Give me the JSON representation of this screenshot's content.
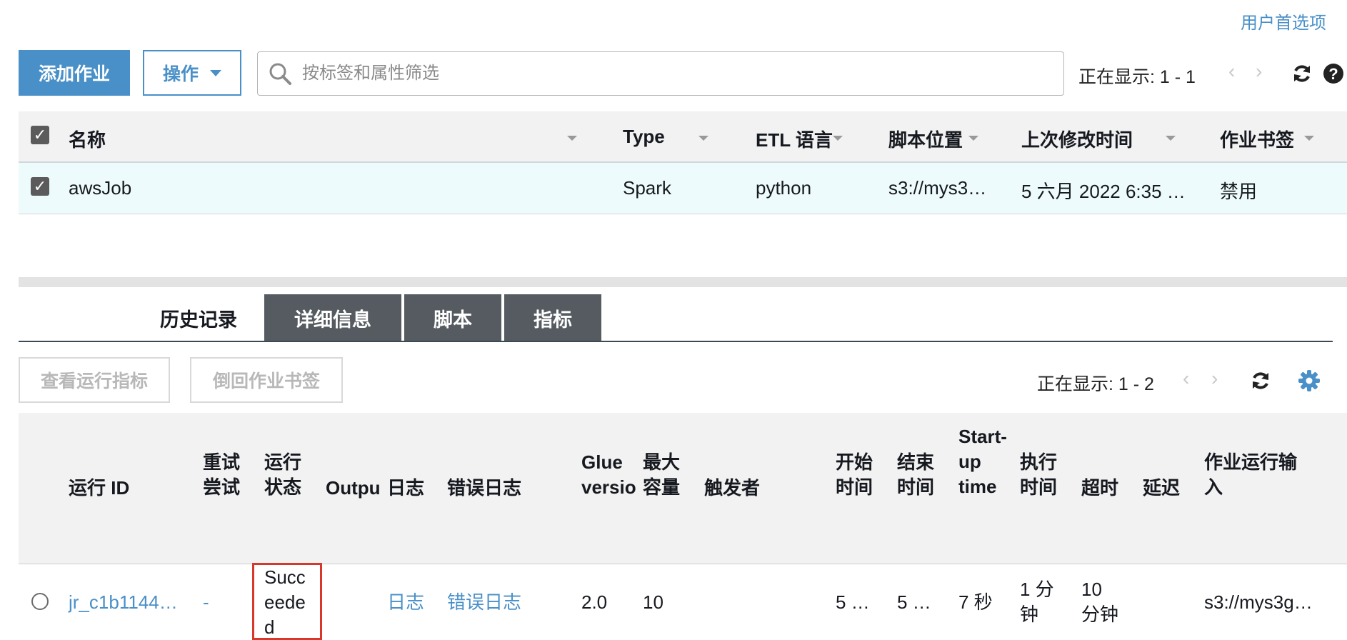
{
  "header": {
    "user_prefs": "用户首选项"
  },
  "toolbar": {
    "add_job": "添加作业",
    "actions": "操作",
    "search_placeholder": "按标签和属性筛选",
    "pager": "正在显示: 1 - 1",
    "prev": "‹",
    "next": "›"
  },
  "jobs_table": {
    "columns": [
      "名称",
      "Type",
      "ETL 语言",
      "脚本位置",
      "上次修改时间",
      "作业书签"
    ],
    "rows": [
      {
        "name": "awsJob",
        "type": "Spark",
        "etl": "python",
        "script": "s3://mys3…",
        "modified": "5 六月 2022 6:35 …",
        "bookmark": "禁用"
      }
    ]
  },
  "tabs": {
    "active": "历史记录",
    "details": "详细信息",
    "script": "脚本",
    "metrics": "指标"
  },
  "history_toolbar": {
    "view_metrics": "查看运行指标",
    "rewind_bookmark": "倒回作业书签",
    "pager": "正在显示: 1 - 2",
    "prev": "‹",
    "next": "›"
  },
  "history_table": {
    "columns": {
      "run_id": "运行 ID",
      "retry_1": "重试",
      "retry_2": "尝试",
      "status_1": "运行",
      "status_2": "状态",
      "output": "Output",
      "logs": "日志",
      "error_logs": "错误日志",
      "glue_1": "Glue",
      "glue_2": "version",
      "capacity_1": "最大",
      "capacity_2": "容量",
      "trigger": "触发者",
      "start_1": "开始",
      "start_2": "时间",
      "end_1": "结束",
      "end_2": "时间",
      "startup_1": "Start-",
      "startup_2": "up",
      "startup_3": "time",
      "exec_1": "执行",
      "exec_2": "时间",
      "timeout": "超时",
      "delay": "延迟",
      "input_1": "作业运行输",
      "input_2": "入"
    },
    "row": {
      "run_id": "jr_c1b1144…",
      "retry": "-",
      "status_1": "Succ",
      "status_2": "eede",
      "status_3": "d",
      "logs": "日志",
      "error_logs": "错误日志",
      "glue": "2.0",
      "capacity": "10",
      "start": "5 …",
      "end": "5 …",
      "startup": "7 秒",
      "exec_1": "1 分",
      "exec_2": "钟",
      "timeout_1": "10",
      "timeout_2": "分钟",
      "input": "s3://mys3g…"
    }
  },
  "colors": {
    "accent": "#4a90c8",
    "tab_dark": "#555b61",
    "highlight_border": "#d9372b",
    "selected_row": "#eefbfd"
  }
}
